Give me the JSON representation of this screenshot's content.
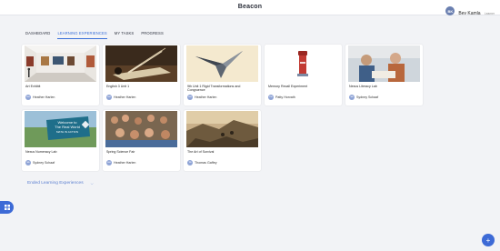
{
  "app": {
    "title": "Beacon"
  },
  "user": {
    "initials": "BK",
    "name": "Bev Kamla",
    "role": "Learner"
  },
  "tabs": [
    {
      "label": "DASHBOARD"
    },
    {
      "label": "LEARNING EXPERIENCES"
    },
    {
      "label": "MY TASKS"
    },
    {
      "label": "PROGRESS"
    }
  ],
  "cards": [
    {
      "title": "Art Exhibit",
      "owner": "Heather Harlen",
      "initials": "HH"
    },
    {
      "title": "English 3 Unit 1",
      "owner": "Heather Harlen",
      "initials": "HH"
    },
    {
      "title": "9th Unit 1 Rigid Transformations and Congruence",
      "owner": "Heather Harlen",
      "initials": "HH"
    },
    {
      "title": "Memory Recall Experiment",
      "owner": "Patty Horvath",
      "initials": "PH"
    },
    {
      "title": "Nexus Literacy Lab",
      "owner": "Sydney Schaaf",
      "initials": "SS"
    },
    {
      "title": "Nexus Numeracy Lab",
      "owner": "Sydney Schaaf",
      "initials": "SS"
    },
    {
      "title": "Spring Science Fair",
      "owner": "Heather Harlen",
      "initials": "HH"
    },
    {
      "title": "The Art of Survival",
      "owner": "Thomas Gaffey",
      "initials": "TG"
    }
  ],
  "sign": {
    "line1": "Welcome to",
    "line2": "The Real World",
    "line3": "MATH IN ACTION"
  },
  "ended": {
    "label": "Ended Learning Experiences"
  },
  "fab": {
    "label": "+"
  }
}
